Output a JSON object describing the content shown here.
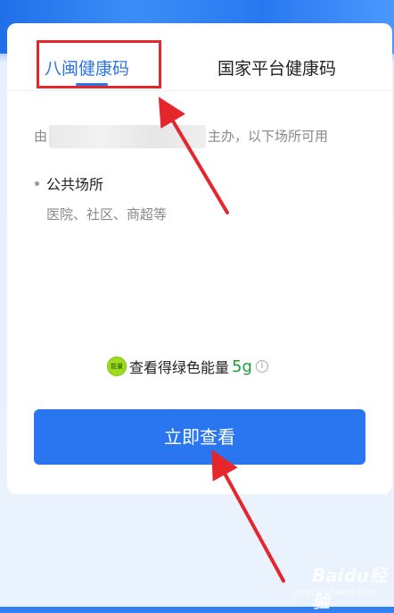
{
  "tabs": [
    {
      "label": "八闽健康码",
      "active": true
    },
    {
      "label": "国家平台健康码",
      "active": false
    }
  ],
  "host": {
    "prefix": "由",
    "suffix": "主办，以下场所可用"
  },
  "venue": {
    "title": "公共场所",
    "description": "医院、社区、商超等"
  },
  "energy": {
    "badge": "能量",
    "text": "查看得绿色能量",
    "amount": "5g",
    "info_icon": "info-icon"
  },
  "action": {
    "label": "立即查看"
  },
  "watermark": {
    "text": "Baidu经验",
    "sub": "jingyan.baidu.com"
  },
  "colors": {
    "accent": "#2b74e8",
    "button": "#2a76f0",
    "energy": "#1a9e3a",
    "annotation": "#e5262c"
  }
}
